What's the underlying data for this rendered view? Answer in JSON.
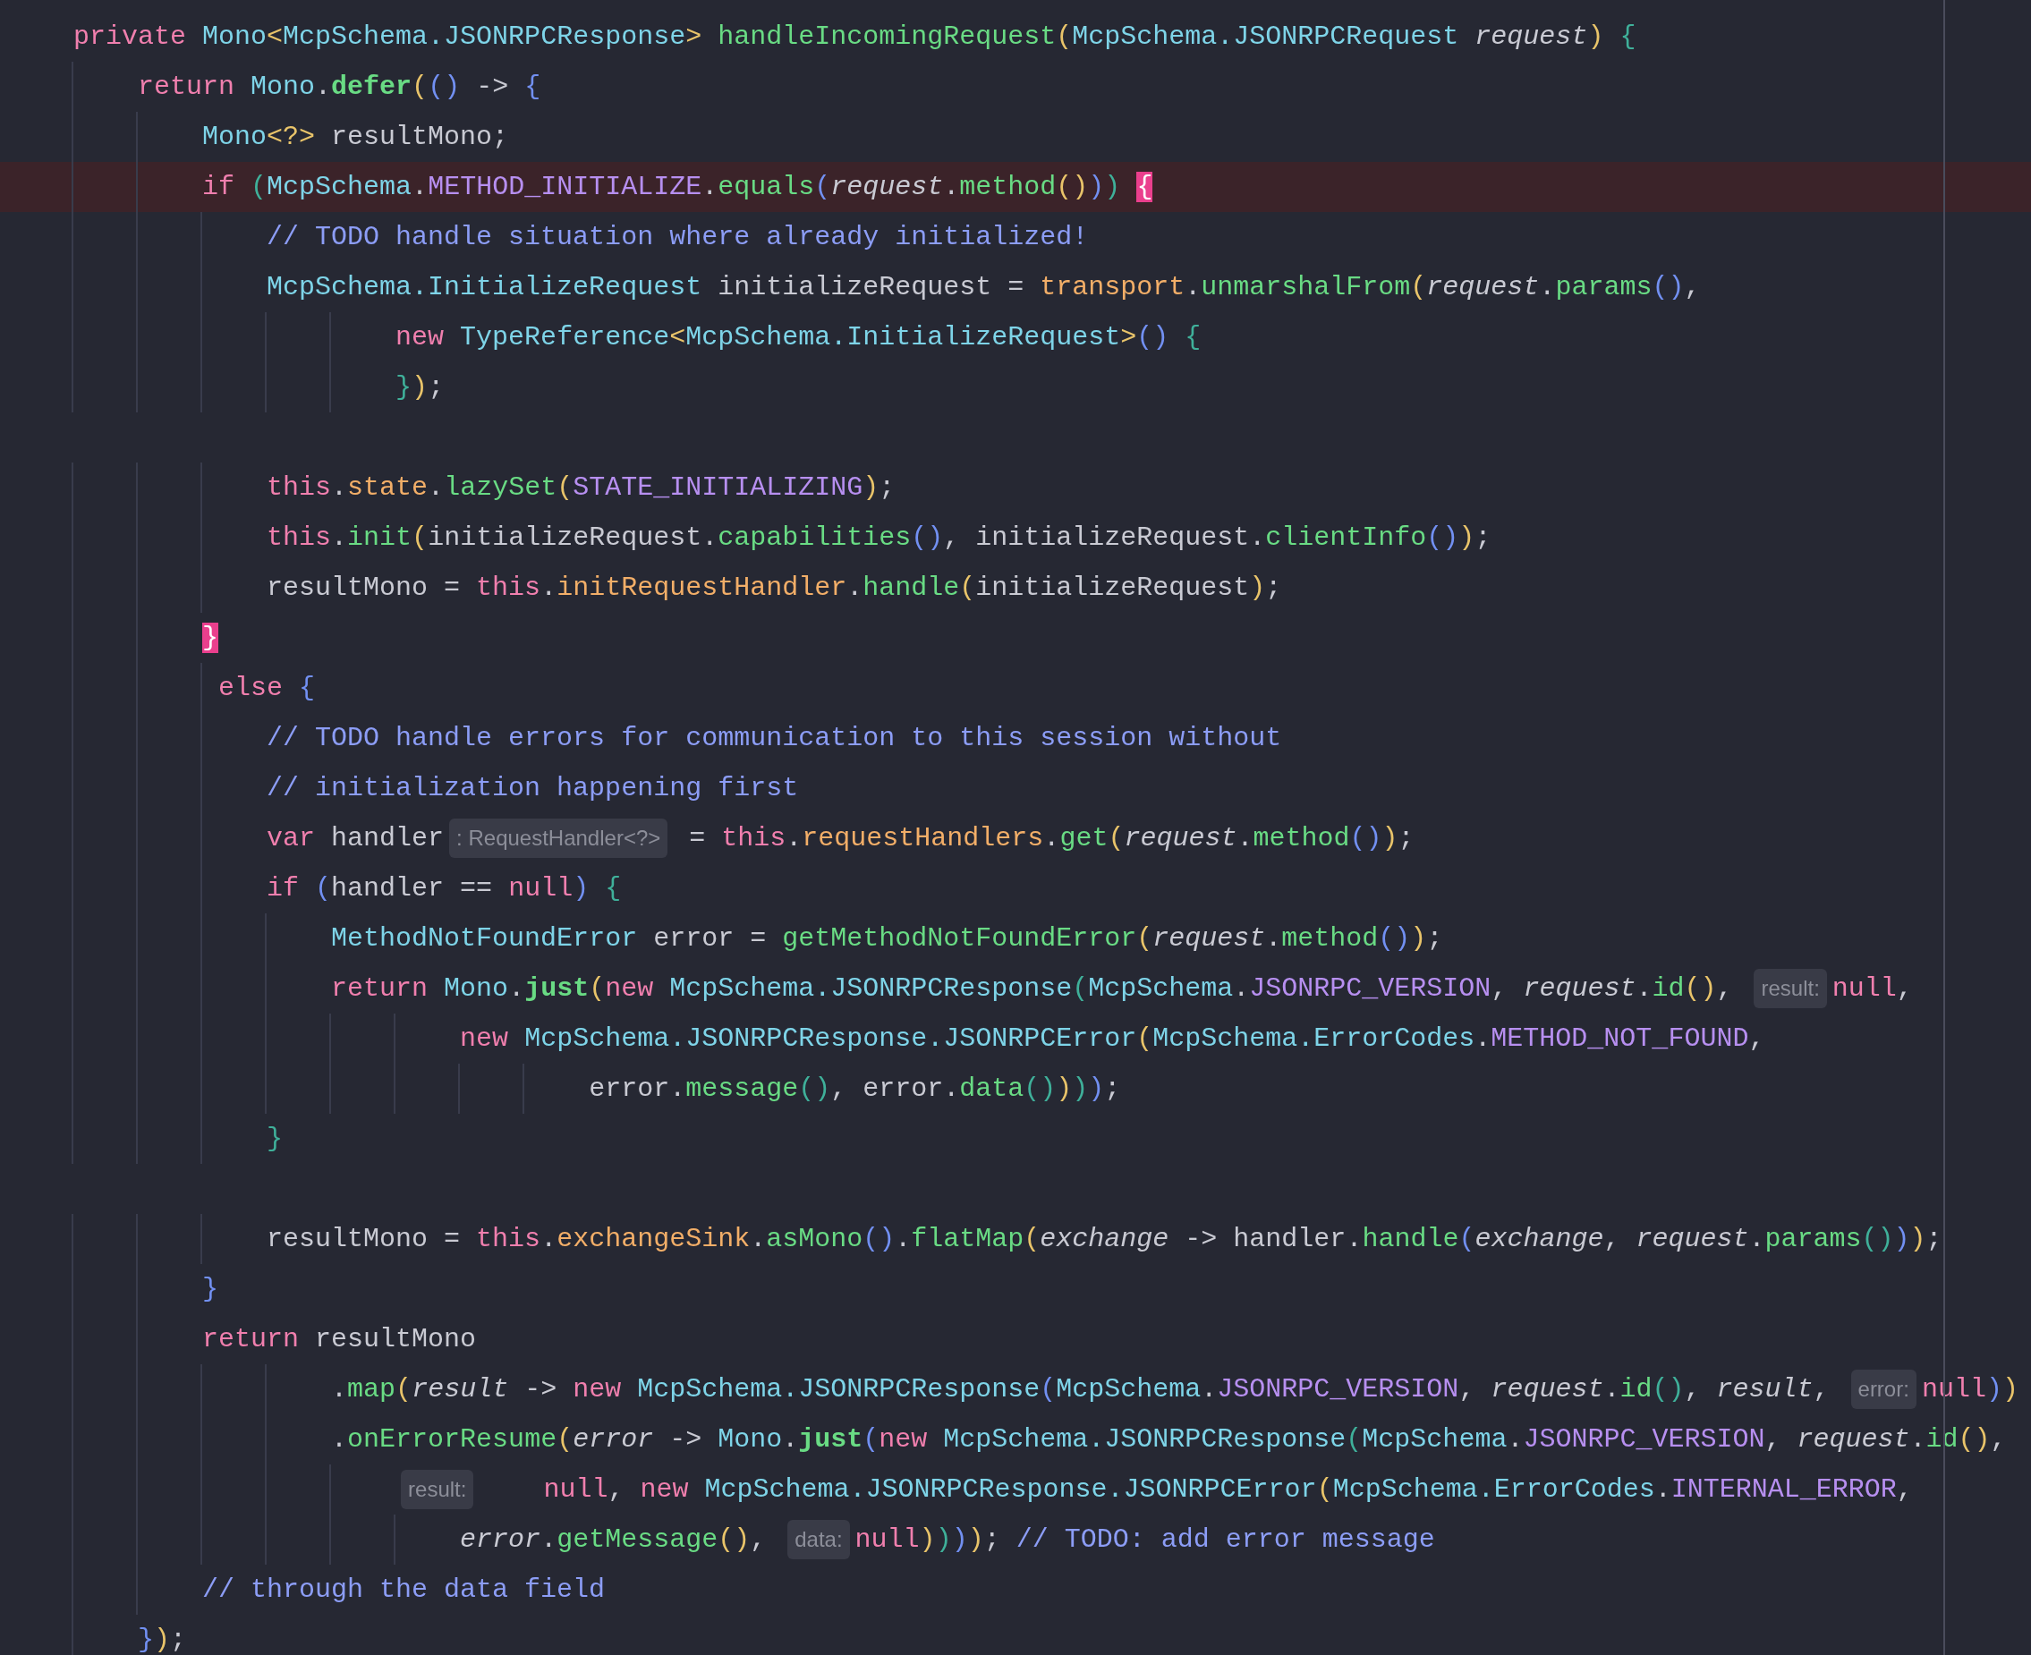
{
  "editor": {
    "lines": [
      {
        "kind": "code",
        "current": false,
        "segments": [
          {
            "kind": "code",
            "tokens": [
              {
                "text": "    private ",
                "kind": "kw"
              },
              {
                "text": "Mono",
                "kind": "type"
              },
              {
                "text": "<",
                "kind": "y"
              },
              {
                "text": "McpSchema.JSONRPCResponse",
                "kind": "type"
              },
              {
                "text": ">",
                "kind": "y"
              },
              {
                "text": " handleIncomingRequest",
                "kind": "fn"
              },
              {
                "text": "(",
                "kind": "y"
              },
              {
                "text": "McpSchema.JSONRPCRequest",
                "kind": "type"
              },
              {
                "text": " request",
                "kind": "it"
              },
              {
                "text": ")",
                "kind": "y"
              },
              {
                "text": " {",
                "kind": "g"
              }
            ]
          }
        ]
      },
      {
        "kind": "code",
        "current": false,
        "segments": [
          {
            "kind": "code",
            "tokens": [
              {
                "text": "        return ",
                "kind": "kw"
              },
              {
                "text": "Mono",
                "kind": "type"
              },
              {
                "text": ".",
                "kind": "tx"
              },
              {
                "text": "defer",
                "kind": "fnb"
              },
              {
                "text": "(",
                "kind": "y"
              },
              {
                "text": "()",
                "kind": "b"
              },
              {
                "text": " -> ",
                "kind": "tx"
              },
              {
                "text": "{",
                "kind": "b"
              }
            ]
          }
        ]
      },
      {
        "kind": "code",
        "current": false,
        "segments": [
          {
            "kind": "code",
            "tokens": [
              {
                "text": "            Mono",
                "kind": "type"
              },
              {
                "text": "<?>",
                "kind": "y"
              },
              {
                "text": " resultMono;",
                "kind": "tx"
              }
            ]
          }
        ]
      },
      {
        "kind": "code",
        "current": true,
        "segments": [
          {
            "kind": "code",
            "tokens": [
              {
                "text": "            if ",
                "kind": "kw"
              },
              {
                "text": "(",
                "kind": "g"
              },
              {
                "text": "McpSchema",
                "kind": "type"
              },
              {
                "text": ".",
                "kind": "tx"
              },
              {
                "text": "METHOD_INITIALIZE",
                "kind": "const"
              },
              {
                "text": ".",
                "kind": "tx"
              },
              {
                "text": "equals",
                "kind": "fn"
              },
              {
                "text": "(",
                "kind": "b"
              },
              {
                "text": "request",
                "kind": "it"
              },
              {
                "text": ".",
                "kind": "tx"
              },
              {
                "text": "method",
                "kind": "fn"
              },
              {
                "text": "()",
                "kind": "y"
              },
              {
                "text": ")",
                "kind": "b"
              },
              {
                "text": ") ",
                "kind": "g"
              },
              {
                "text": "{",
                "kind": "m"
              }
            ]
          }
        ]
      },
      {
        "kind": "code",
        "current": false,
        "segments": [
          {
            "kind": "code",
            "tokens": [
              {
                "text": "                // TODO handle situation where already initialized!",
                "kind": "cm"
              }
            ]
          }
        ]
      },
      {
        "kind": "code",
        "current": false,
        "segments": [
          {
            "kind": "code",
            "tokens": [
              {
                "text": "                McpSchema.InitializeRequest",
                "kind": "type"
              },
              {
                "text": " initializeRequest = ",
                "kind": "tx"
              },
              {
                "text": "transport",
                "kind": "field"
              },
              {
                "text": ".",
                "kind": "tx"
              },
              {
                "text": "unmarshalFrom",
                "kind": "fn"
              },
              {
                "text": "(",
                "kind": "y"
              },
              {
                "text": "request",
                "kind": "it"
              },
              {
                "text": ".",
                "kind": "tx"
              },
              {
                "text": "params",
                "kind": "fn"
              },
              {
                "text": "()",
                "kind": "b"
              },
              {
                "text": ",",
                "kind": "tx"
              }
            ]
          }
        ]
      },
      {
        "kind": "code",
        "current": false,
        "segments": [
          {
            "kind": "code",
            "tokens": [
              {
                "text": "                        new ",
                "kind": "kw"
              },
              {
                "text": "TypeReference",
                "kind": "type"
              },
              {
                "text": "<",
                "kind": "y"
              },
              {
                "text": "McpSchema.InitializeRequest",
                "kind": "type"
              },
              {
                "text": ">",
                "kind": "y"
              },
              {
                "text": "()",
                "kind": "b"
              },
              {
                "text": " {",
                "kind": "g"
              }
            ]
          }
        ]
      },
      {
        "kind": "code",
        "current": false,
        "segments": [
          {
            "kind": "code",
            "tokens": [
              {
                "text": "                        }",
                "kind": "g"
              },
              {
                "text": ")",
                "kind": "y"
              },
              {
                "text": ";",
                "kind": "tx"
              }
            ]
          }
        ]
      },
      {
        "kind": "blank",
        "current": false
      },
      {
        "kind": "code",
        "current": false,
        "segments": [
          {
            "kind": "code",
            "tokens": [
              {
                "text": "                this",
                "kind": "kw"
              },
              {
                "text": ".",
                "kind": "tx"
              },
              {
                "text": "state",
                "kind": "field"
              },
              {
                "text": ".",
                "kind": "tx"
              },
              {
                "text": "lazySet",
                "kind": "fn"
              },
              {
                "text": "(",
                "kind": "y"
              },
              {
                "text": "STATE_INITIALIZING",
                "kind": "const"
              },
              {
                "text": ")",
                "kind": "y"
              },
              {
                "text": ";",
                "kind": "tx"
              }
            ]
          }
        ]
      },
      {
        "kind": "code",
        "current": false,
        "segments": [
          {
            "kind": "code",
            "tokens": [
              {
                "text": "                this",
                "kind": "kw"
              },
              {
                "text": ".",
                "kind": "tx"
              },
              {
                "text": "init",
                "kind": "fn"
              },
              {
                "text": "(",
                "kind": "y"
              },
              {
                "text": "initializeRequest.",
                "kind": "tx"
              },
              {
                "text": "capabilities",
                "kind": "fn"
              },
              {
                "text": "()",
                "kind": "b"
              },
              {
                "text": ", initializeRequest.",
                "kind": "tx"
              },
              {
                "text": "clientInfo",
                "kind": "fn"
              },
              {
                "text": "()",
                "kind": "b"
              },
              {
                "text": ")",
                "kind": "y"
              },
              {
                "text": ";",
                "kind": "tx"
              }
            ]
          }
        ]
      },
      {
        "kind": "code",
        "current": false,
        "segments": [
          {
            "kind": "code",
            "tokens": [
              {
                "text": "                resultMono = ",
                "kind": "tx"
              },
              {
                "text": "this",
                "kind": "kw"
              },
              {
                "text": ".",
                "kind": "tx"
              },
              {
                "text": "initRequestHandler",
                "kind": "field"
              },
              {
                "text": ".",
                "kind": "tx"
              },
              {
                "text": "handle",
                "kind": "fn"
              },
              {
                "text": "(",
                "kind": "y"
              },
              {
                "text": "initializeRequest",
                "kind": "tx"
              },
              {
                "text": ")",
                "kind": "y"
              },
              {
                "text": ";",
                "kind": "tx"
              }
            ]
          }
        ]
      },
      {
        "kind": "code",
        "current": false,
        "segments": [
          {
            "kind": "code",
            "tokens": [
              {
                "text": "            }",
                "kind": "m"
              }
            ]
          }
        ]
      },
      {
        "kind": "code",
        "current": false,
        "segments": [
          {
            "kind": "code",
            "tokens": [
              {
                "text": "             else ",
                "kind": "kw"
              },
              {
                "text": "{",
                "kind": "b"
              }
            ]
          }
        ]
      },
      {
        "kind": "code",
        "current": false,
        "segments": [
          {
            "kind": "code",
            "tokens": [
              {
                "text": "                // TODO handle errors for communication to this session without",
                "kind": "cm"
              }
            ]
          }
        ]
      },
      {
        "kind": "code",
        "current": false,
        "segments": [
          {
            "kind": "code",
            "tokens": [
              {
                "text": "                // initialization happening first",
                "kind": "cm"
              }
            ]
          }
        ]
      },
      {
        "kind": "code",
        "current": false,
        "segments": [
          {
            "kind": "code",
            "tokens": [
              {
                "text": "                var ",
                "kind": "kw"
              },
              {
                "text": "handler",
                "kind": "tx"
              }
            ]
          },
          {
            "kind": "hint",
            "text": ": RequestHandler<?>"
          },
          {
            "kind": "code",
            "tokens": [
              {
                "text": " = ",
                "kind": "tx"
              },
              {
                "text": "this",
                "kind": "kw"
              },
              {
                "text": ".",
                "kind": "tx"
              },
              {
                "text": "requestHandlers",
                "kind": "field"
              },
              {
                "text": ".",
                "kind": "tx"
              },
              {
                "text": "get",
                "kind": "fn"
              },
              {
                "text": "(",
                "kind": "y"
              },
              {
                "text": "request",
                "kind": "it"
              },
              {
                "text": ".",
                "kind": "tx"
              },
              {
                "text": "method",
                "kind": "fn"
              },
              {
                "text": "()",
                "kind": "b"
              },
              {
                "text": ")",
                "kind": "y"
              },
              {
                "text": ";",
                "kind": "tx"
              }
            ]
          }
        ]
      },
      {
        "kind": "code",
        "current": false,
        "segments": [
          {
            "kind": "code",
            "tokens": [
              {
                "text": "                if ",
                "kind": "kw"
              },
              {
                "text": "(",
                "kind": "b"
              },
              {
                "text": "handler == ",
                "kind": "tx"
              },
              {
                "text": "null",
                "kind": "kw"
              },
              {
                "text": ")",
                "kind": "b"
              },
              {
                "text": " {",
                "kind": "g"
              }
            ]
          }
        ]
      },
      {
        "kind": "code",
        "current": false,
        "segments": [
          {
            "kind": "code",
            "tokens": [
              {
                "text": "                    MethodNotFoundError",
                "kind": "type"
              },
              {
                "text": " error = ",
                "kind": "tx"
              },
              {
                "text": "getMethodNotFoundError",
                "kind": "fn"
              },
              {
                "text": "(",
                "kind": "y"
              },
              {
                "text": "request",
                "kind": "it"
              },
              {
                "text": ".",
                "kind": "tx"
              },
              {
                "text": "method",
                "kind": "fn"
              },
              {
                "text": "()",
                "kind": "b"
              },
              {
                "text": ")",
                "kind": "y"
              },
              {
                "text": ";",
                "kind": "tx"
              }
            ]
          }
        ]
      },
      {
        "kind": "code",
        "current": false,
        "segments": [
          {
            "kind": "code",
            "tokens": [
              {
                "text": "                    return ",
                "kind": "kw"
              },
              {
                "text": "Mono",
                "kind": "type"
              },
              {
                "text": ".",
                "kind": "tx"
              },
              {
                "text": "just",
                "kind": "fnb"
              },
              {
                "text": "(",
                "kind": "y"
              },
              {
                "text": "new ",
                "kind": "kw"
              },
              {
                "text": "McpSchema.JSONRPCResponse",
                "kind": "type"
              },
              {
                "text": "(",
                "kind": "g"
              },
              {
                "text": "McpSchema",
                "kind": "type"
              },
              {
                "text": ".",
                "kind": "tx"
              },
              {
                "text": "JSONRPC_VERSION",
                "kind": "const"
              },
              {
                "text": ", ",
                "kind": "tx"
              },
              {
                "text": "request",
                "kind": "it"
              },
              {
                "text": ".",
                "kind": "tx"
              },
              {
                "text": "id",
                "kind": "fn"
              },
              {
                "text": "()",
                "kind": "y"
              },
              {
                "text": ", ",
                "kind": "tx"
              }
            ]
          },
          {
            "kind": "hint",
            "text": "result:"
          },
          {
            "kind": "code",
            "tokens": [
              {
                "text": "null",
                "kind": "kw"
              },
              {
                "text": ",",
                "kind": "tx"
              }
            ]
          }
        ]
      },
      {
        "kind": "code",
        "current": false,
        "segments": [
          {
            "kind": "code",
            "tokens": [
              {
                "text": "                            new ",
                "kind": "kw"
              },
              {
                "text": "McpSchema.JSONRPCResponse.JSONRPCError",
                "kind": "type"
              },
              {
                "text": "(",
                "kind": "y"
              },
              {
                "text": "McpSchema.ErrorCodes",
                "kind": "type"
              },
              {
                "text": ".",
                "kind": "tx"
              },
              {
                "text": "METHOD_NOT_FOUND",
                "kind": "const"
              },
              {
                "text": ",",
                "kind": "tx"
              }
            ]
          }
        ]
      },
      {
        "kind": "code",
        "current": false,
        "segments": [
          {
            "kind": "code",
            "tokens": [
              {
                "text": "                                    error.",
                "kind": "tx"
              },
              {
                "text": "message",
                "kind": "fn"
              },
              {
                "text": "()",
                "kind": "g"
              },
              {
                "text": ", error.",
                "kind": "tx"
              },
              {
                "text": "data",
                "kind": "fn"
              },
              {
                "text": "()",
                "kind": "g"
              },
              {
                "text": ")",
                "kind": "y"
              },
              {
                "text": ")",
                "kind": "g"
              },
              {
                "text": ")",
                "kind": "b"
              },
              {
                "text": ";",
                "kind": "tx"
              }
            ]
          }
        ]
      },
      {
        "kind": "code",
        "current": false,
        "segments": [
          {
            "kind": "code",
            "tokens": [
              {
                "text": "                }",
                "kind": "g"
              }
            ]
          }
        ]
      },
      {
        "kind": "blank",
        "current": false
      },
      {
        "kind": "code",
        "current": false,
        "segments": [
          {
            "kind": "code",
            "tokens": [
              {
                "text": "                resultMono = ",
                "kind": "tx"
              },
              {
                "text": "this",
                "kind": "kw"
              },
              {
                "text": ".",
                "kind": "tx"
              },
              {
                "text": "exchangeSink",
                "kind": "field"
              },
              {
                "text": ".",
                "kind": "tx"
              },
              {
                "text": "asMono",
                "kind": "fn"
              },
              {
                "text": "()",
                "kind": "b"
              },
              {
                "text": ".",
                "kind": "tx"
              },
              {
                "text": "flatMap",
                "kind": "fn"
              },
              {
                "text": "(",
                "kind": "y"
              },
              {
                "text": "exchange",
                "kind": "it"
              },
              {
                "text": " -> handler.",
                "kind": "tx"
              },
              {
                "text": "handle",
                "kind": "fn"
              },
              {
                "text": "(",
                "kind": "b"
              },
              {
                "text": "exchange",
                "kind": "it"
              },
              {
                "text": ", ",
                "kind": "tx"
              },
              {
                "text": "request",
                "kind": "it"
              },
              {
                "text": ".",
                "kind": "tx"
              },
              {
                "text": "params",
                "kind": "fn"
              },
              {
                "text": "()",
                "kind": "g"
              },
              {
                "text": ")",
                "kind": "b"
              },
              {
                "text": ")",
                "kind": "y"
              },
              {
                "text": ";",
                "kind": "tx"
              }
            ]
          }
        ]
      },
      {
        "kind": "code",
        "current": false,
        "segments": [
          {
            "kind": "code",
            "tokens": [
              {
                "text": "            }",
                "kind": "b"
              }
            ]
          }
        ]
      },
      {
        "kind": "code",
        "current": false,
        "segments": [
          {
            "kind": "code",
            "tokens": [
              {
                "text": "            return ",
                "kind": "kw"
              },
              {
                "text": "resultMono",
                "kind": "tx"
              }
            ]
          }
        ]
      },
      {
        "kind": "code",
        "current": false,
        "segments": [
          {
            "kind": "code",
            "tokens": [
              {
                "text": "                    .",
                "kind": "tx"
              },
              {
                "text": "map",
                "kind": "fn"
              },
              {
                "text": "(",
                "kind": "y"
              },
              {
                "text": "result",
                "kind": "it"
              },
              {
                "text": " -> ",
                "kind": "tx"
              },
              {
                "text": "new ",
                "kind": "kw"
              },
              {
                "text": "McpSchema.JSONRPCResponse",
                "kind": "type"
              },
              {
                "text": "(",
                "kind": "b"
              },
              {
                "text": "McpSchema",
                "kind": "type"
              },
              {
                "text": ".",
                "kind": "tx"
              },
              {
                "text": "JSONRPC_VERSION",
                "kind": "const"
              },
              {
                "text": ", ",
                "kind": "tx"
              },
              {
                "text": "request",
                "kind": "it"
              },
              {
                "text": ".",
                "kind": "tx"
              },
              {
                "text": "id",
                "kind": "fn"
              },
              {
                "text": "()",
                "kind": "g"
              },
              {
                "text": ", ",
                "kind": "tx"
              },
              {
                "text": "result",
                "kind": "it"
              },
              {
                "text": ", ",
                "kind": "tx"
              }
            ]
          },
          {
            "kind": "hint",
            "text": "error:"
          },
          {
            "kind": "code",
            "tokens": [
              {
                "text": "null",
                "kind": "kw"
              },
              {
                "text": ")",
                "kind": "b"
              },
              {
                "text": ")",
                "kind": "y"
              }
            ]
          }
        ]
      },
      {
        "kind": "code",
        "current": false,
        "segments": [
          {
            "kind": "code",
            "tokens": [
              {
                "text": "                    .",
                "kind": "tx"
              },
              {
                "text": "onErrorResume",
                "kind": "fn"
              },
              {
                "text": "(",
                "kind": "y"
              },
              {
                "text": "error",
                "kind": "it"
              },
              {
                "text": " -> ",
                "kind": "tx"
              },
              {
                "text": "Mono",
                "kind": "type"
              },
              {
                "text": ".",
                "kind": "tx"
              },
              {
                "text": "just",
                "kind": "fnb"
              },
              {
                "text": "(",
                "kind": "b"
              },
              {
                "text": "new ",
                "kind": "kw"
              },
              {
                "text": "McpSchema.JSONRPCResponse",
                "kind": "type"
              },
              {
                "text": "(",
                "kind": "g"
              },
              {
                "text": "McpSchema",
                "kind": "type"
              },
              {
                "text": ".",
                "kind": "tx"
              },
              {
                "text": "JSONRPC_VERSION",
                "kind": "const"
              },
              {
                "text": ", ",
                "kind": "tx"
              },
              {
                "text": "request",
                "kind": "it"
              },
              {
                "text": ".",
                "kind": "tx"
              },
              {
                "text": "id",
                "kind": "fn"
              },
              {
                "text": "()",
                "kind": "y"
              },
              {
                "text": ",",
                "kind": "tx"
              }
            ]
          }
        ]
      },
      {
        "kind": "code",
        "current": false,
        "segments": [
          {
            "kind": "hint",
            "text": "                        result:"
          },
          {
            "kind": "code",
            "tokens": [
              {
                "text": "    null",
                "kind": "kw"
              },
              {
                "text": ", ",
                "kind": "tx"
              },
              {
                "text": "new ",
                "kind": "kw"
              },
              {
                "text": "McpSchema.JSONRPCResponse.JSONRPCError",
                "kind": "type"
              },
              {
                "text": "(",
                "kind": "y"
              },
              {
                "text": "McpSchema.ErrorCodes",
                "kind": "type"
              },
              {
                "text": ".",
                "kind": "tx"
              },
              {
                "text": "INTERNAL_ERROR",
                "kind": "const"
              },
              {
                "text": ",",
                "kind": "tx"
              }
            ]
          }
        ]
      },
      {
        "kind": "code",
        "current": false,
        "segments": [
          {
            "kind": "code",
            "tokens": [
              {
                "text": "                            error",
                "kind": "it"
              },
              {
                "text": ".",
                "kind": "tx"
              },
              {
                "text": "getMessage",
                "kind": "fn"
              },
              {
                "text": "()",
                "kind": "y"
              },
              {
                "text": ", ",
                "kind": "tx"
              }
            ]
          },
          {
            "kind": "hint",
            "text": "data:"
          },
          {
            "kind": "code",
            "tokens": [
              {
                "text": "null",
                "kind": "kw"
              },
              {
                "text": ")",
                "kind": "y"
              },
              {
                "text": ")",
                "kind": "g"
              },
              {
                "text": ")",
                "kind": "b"
              },
              {
                "text": ")",
                "kind": "y"
              },
              {
                "text": "; ",
                "kind": "tx"
              },
              {
                "text": "// TODO: add error message",
                "kind": "cm"
              }
            ]
          }
        ]
      },
      {
        "kind": "code",
        "current": false,
        "segments": [
          {
            "kind": "code",
            "tokens": [
              {
                "text": "            // through the data field",
                "kind": "cm"
              }
            ]
          }
        ]
      },
      {
        "kind": "code",
        "current": false,
        "segments": [
          {
            "kind": "code",
            "tokens": [
              {
                "text": "        }",
                "kind": "b"
              },
              {
                "text": ")",
                "kind": "y"
              },
              {
                "text": ";",
                "kind": "tx"
              }
            ]
          }
        ]
      }
    ]
  }
}
